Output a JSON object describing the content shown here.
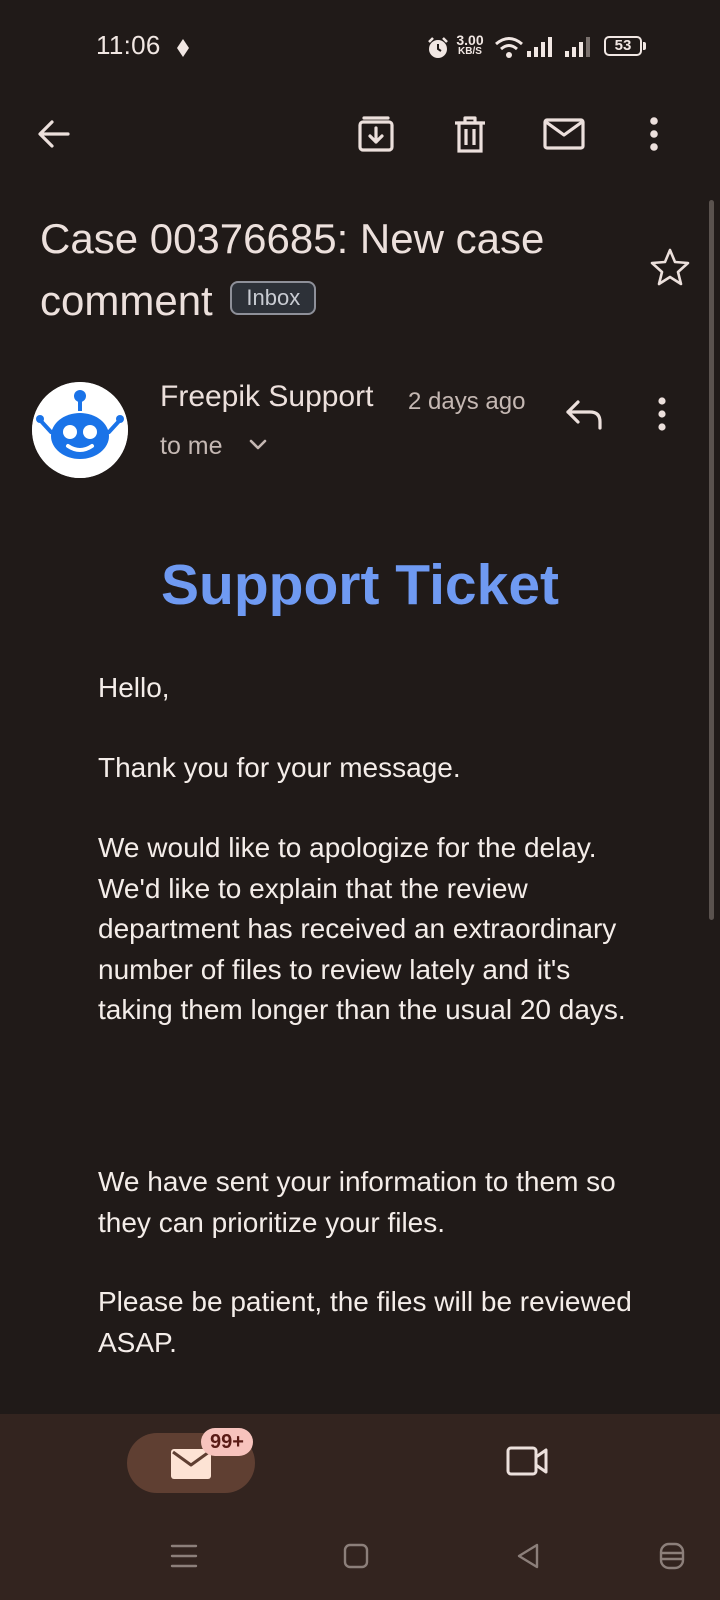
{
  "status_bar": {
    "time": "11:06",
    "net_speed_value": "3.00",
    "net_speed_unit": "KB/S",
    "battery": "53"
  },
  "toolbar": {
    "icons": [
      "back-arrow-icon",
      "archive-icon",
      "delete-icon",
      "mark-unread-icon",
      "more-vert-icon"
    ]
  },
  "email": {
    "subject": "Case 00376685: New case comment",
    "label": "Inbox",
    "sender": "Freepik Support",
    "time": "2 days ago",
    "recipient": "to me",
    "body_title": "Support Ticket",
    "paragraphs": [
      "Hello,",
      "Thank you for your message.",
      "We would like to apologize for the delay. We'd like to explain that the review department has received an extraordinary number of files to review lately and it's taking them longer than the usual 20 days.",
      "We have sent your information to them so they can prioritize your files.",
      "Please be patient, the files will be reviewed ASAP."
    ]
  },
  "bottom_nav": {
    "mail_badge": "99+",
    "tabs": [
      "mail-icon",
      "video-call-icon"
    ]
  },
  "colors": {
    "background": "#201a18",
    "accent_title": "#6f9af2",
    "nav_background": "#33241f",
    "avatar_blue": "#1a73e8",
    "badge_background": "#f7c3bd"
  }
}
